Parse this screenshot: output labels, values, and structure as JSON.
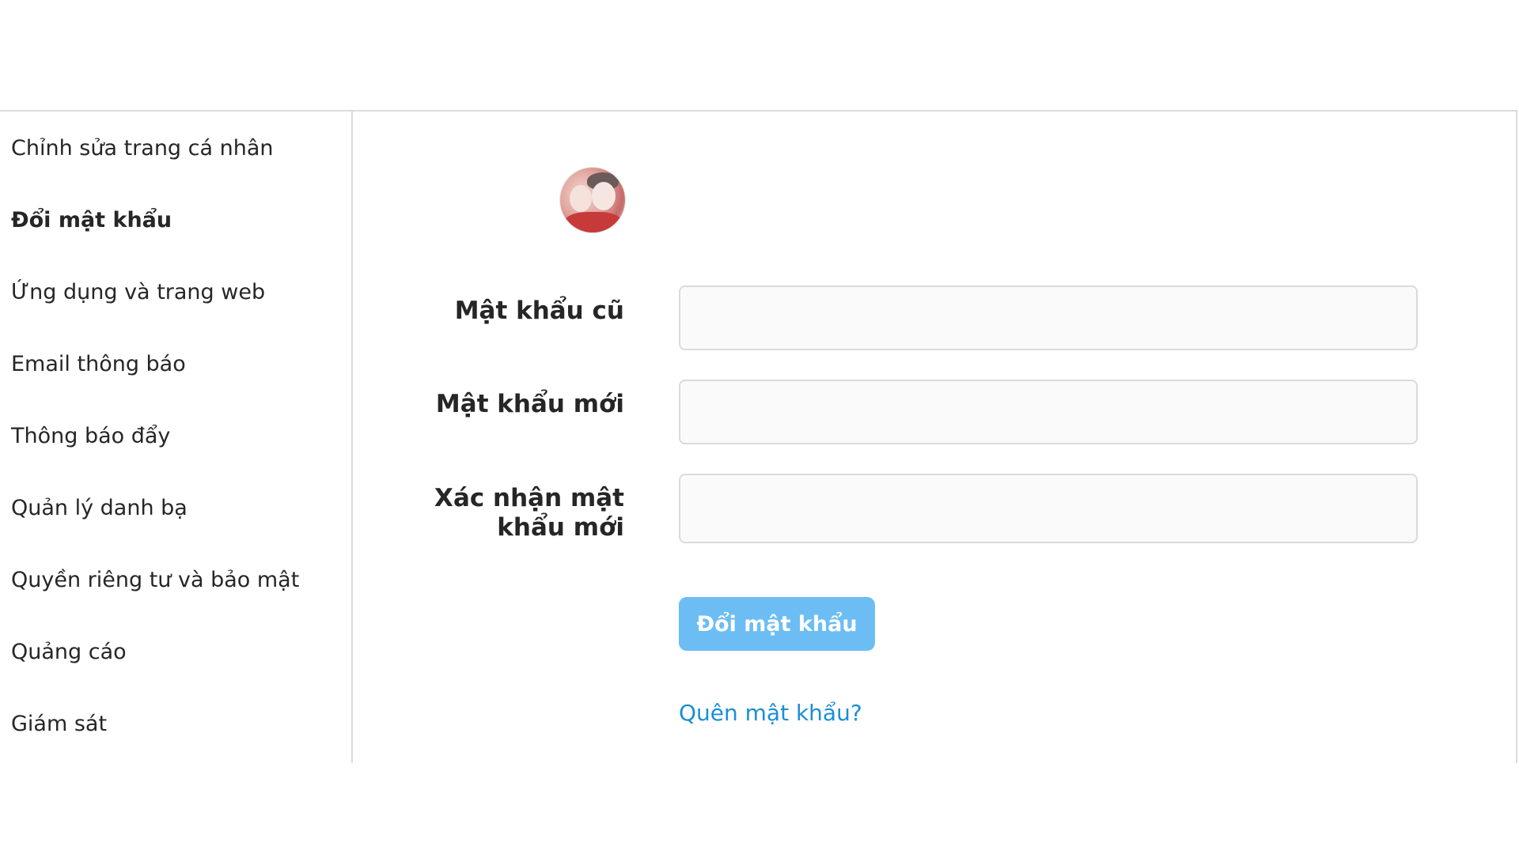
{
  "sidebar": {
    "items": [
      {
        "label": "Chỉnh sửa trang cá nhân"
      },
      {
        "label": "Đổi mật khẩu"
      },
      {
        "label": "Ứng dụng và trang web"
      },
      {
        "label": "Email thông báo"
      },
      {
        "label": "Thông báo đẩy"
      },
      {
        "label": "Quản lý danh bạ"
      },
      {
        "label": "Quyền riêng tư và bảo mật"
      },
      {
        "label": "Quảng cáo"
      },
      {
        "label": "Giám sát"
      }
    ],
    "active_index": 1
  },
  "form": {
    "old_password": {
      "label": "Mật khẩu cũ",
      "value": ""
    },
    "new_password": {
      "label": "Mật khẩu mới",
      "value": ""
    },
    "confirm_password": {
      "label_line1": "Xác nhận mật",
      "label_line2": "khẩu mới",
      "value": ""
    },
    "submit_label": "Đổi mật khẩu",
    "forgot_label": "Quên mật khẩu?"
  },
  "colors": {
    "accent_button": "#6cbdf4",
    "link": "#1a8fd6",
    "border": "#dbdbdb"
  }
}
